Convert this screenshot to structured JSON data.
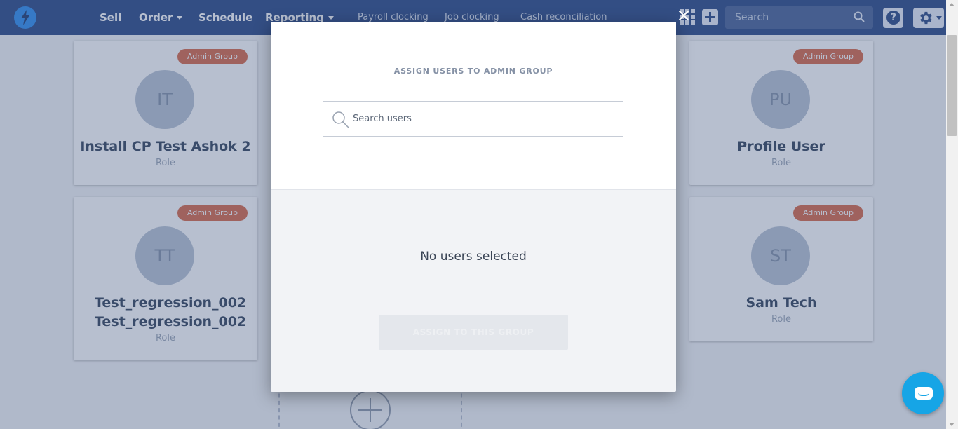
{
  "nav": {
    "items": [
      {
        "label": "Sell",
        "has_dropdown": false
      },
      {
        "label": "Order",
        "has_dropdown": true
      },
      {
        "label": "Schedule",
        "has_dropdown": false
      },
      {
        "label": "Reporting",
        "has_dropdown": true
      }
    ],
    "sub_items": [
      "Payroll clocking",
      "Job clocking",
      "Cash reconciliation"
    ],
    "search_placeholder": "Search",
    "help_label": "?",
    "icons": {
      "logo": "lightning-logo-icon",
      "apps": "apps-grid-icon",
      "add": "plus-icon",
      "search": "search-icon",
      "help": "help-icon",
      "settings": "gear-icon"
    }
  },
  "cards": [
    {
      "badge": "Admin Group",
      "initials": "IT",
      "name": "Install CP Test Ashok 2",
      "role": "Role"
    },
    {
      "badge": "Admin Group",
      "initials": "PU",
      "name": "Profile User",
      "role": "Role"
    },
    {
      "badge": "Admin Group",
      "initials": "TT",
      "name": "Test_regression_002 Test_regression_002",
      "role": "Role"
    },
    {
      "badge": "Admin Group",
      "initials": "ST",
      "name": "Sam Tech",
      "role": "Role"
    }
  ],
  "modal": {
    "title": "ASSIGN USERS TO ADMIN GROUP",
    "search_placeholder": "Search users",
    "empty_message": "No users selected",
    "assign_button": "ASSIGN TO THIS GROUP"
  },
  "colors": {
    "topbar": "#2b4a86",
    "badge": "#d86a4a",
    "chat": "#16a5e6"
  }
}
